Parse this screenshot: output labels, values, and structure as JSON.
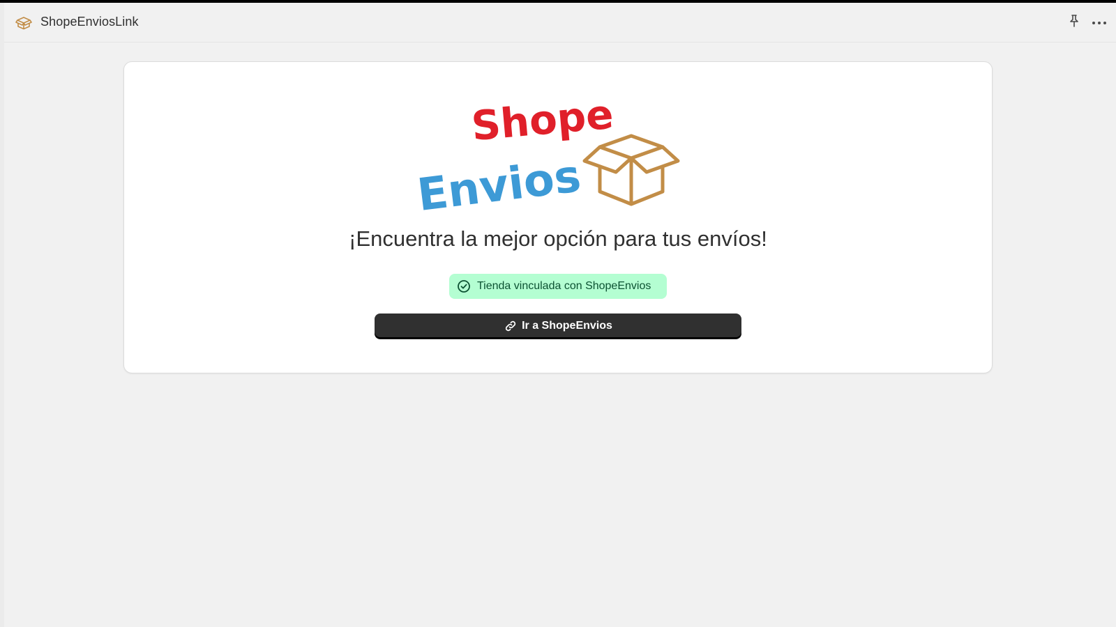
{
  "app": {
    "title": "ShopeEnviosLink",
    "icon": "package-icon"
  },
  "header_actions": {
    "pin_icon": "pin-icon",
    "more_icon": "more-horizontal-icon"
  },
  "logo": {
    "line1": "Shope",
    "line2": "Envios",
    "colors": {
      "shope": "#e0202a",
      "envios": "#3d9ad6",
      "box": "#c28d47"
    }
  },
  "main": {
    "headline": "¡Encuentra la mejor opción para tus envíos!",
    "status_badge": {
      "text": "Tienda vinculada con ShopeEnvios",
      "icon": "check-circle-icon",
      "bg": "#b4fed2",
      "fg": "#0c5132"
    },
    "cta": {
      "label": "Ir a ShopeEnvios",
      "icon": "link-icon",
      "bg": "#303030"
    }
  }
}
